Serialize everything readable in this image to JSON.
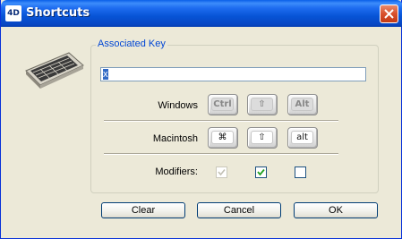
{
  "window": {
    "title": "Shortcuts",
    "app_icon_text": "4D"
  },
  "group": {
    "label": "Associated Key",
    "key_value": "x"
  },
  "rows": {
    "windows_label": "Windows",
    "macintosh_label": "Macintosh",
    "modifiers_label": "Modifiers:"
  },
  "windows_keys": {
    "ctrl": "Ctrl",
    "shift": "⇧",
    "alt": "Alt"
  },
  "mac_keys": {
    "cmd": " ⌘",
    "shift": "⇧",
    "option": "alt"
  },
  "modifiers": {
    "first": {
      "checked": true,
      "enabled": false
    },
    "second": {
      "checked": true,
      "enabled": true
    },
    "third": {
      "checked": false,
      "enabled": true
    }
  },
  "buttons": {
    "clear": "Clear",
    "cancel": "Cancel",
    "ok": "OK"
  },
  "colors": {
    "title_bar": "#0754d6",
    "group_label": "#0046d5",
    "checkbox_check": "#21a121"
  }
}
